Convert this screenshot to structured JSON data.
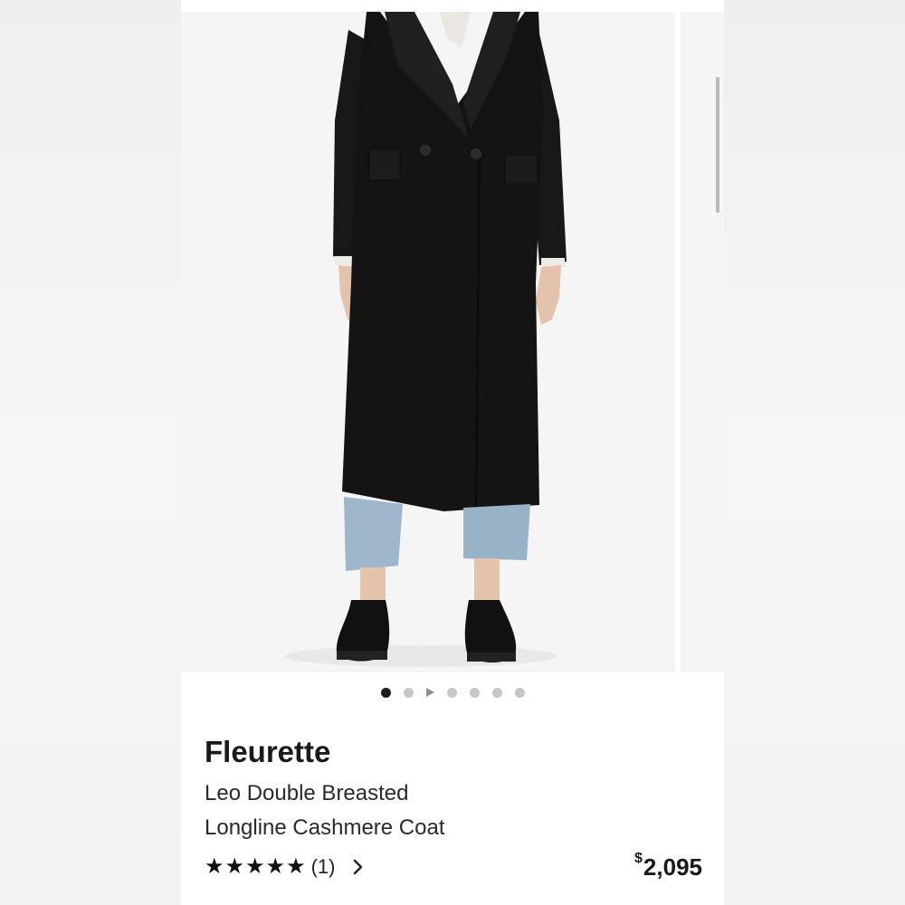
{
  "product": {
    "brand": "Fleurette",
    "name_line1": "Leo Double Breasted",
    "name_line2": "Longline Cashmere Coat",
    "rating_stars": 5,
    "review_count": "(1)",
    "price_symbol": "$",
    "price_value": "2,095"
  },
  "gallery": {
    "image_count": 7,
    "active_index": 0,
    "video_index": 2,
    "image_description": "model-wearing-black-longline-coat",
    "colors": {
      "coat": "#141414",
      "jeans": "#9db6cc",
      "background": "#f5f5f5"
    }
  },
  "icons": {
    "star": "star-icon",
    "chevron": "chevron-right-icon",
    "video": "play-icon"
  }
}
